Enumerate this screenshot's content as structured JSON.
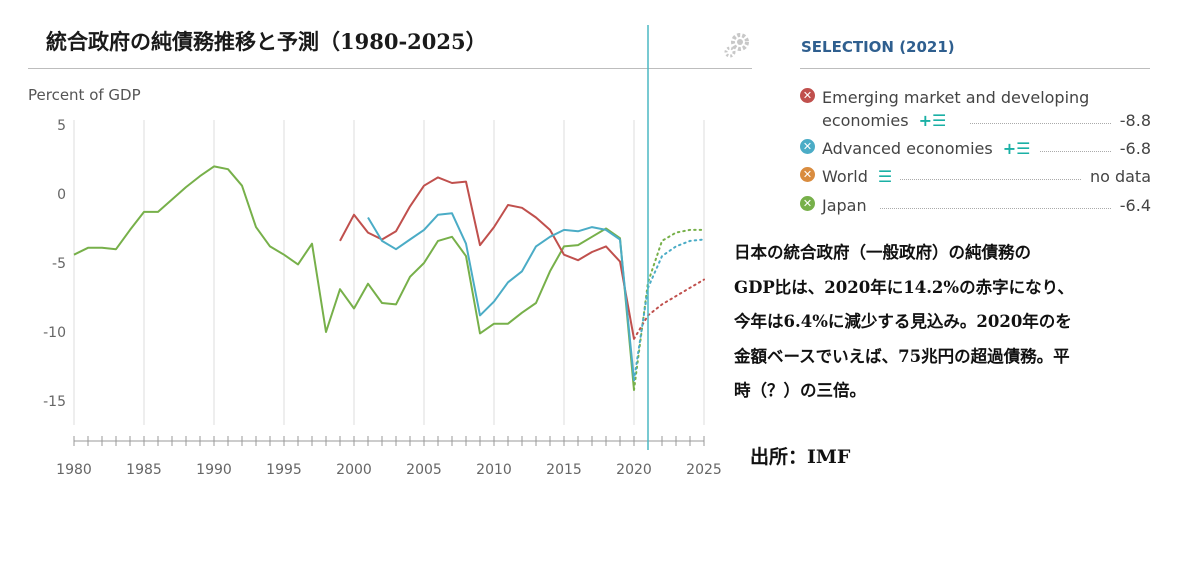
{
  "title": "統合政府の純債務推移と予測（1980-2025）",
  "selection_title": "SELECTION (2021)",
  "legend": [
    {
      "name_line1": "Emerging market and developing",
      "name_line2": "economies",
      "value": "-8.8",
      "color": "#c0504d",
      "icon": "plus-list-icon"
    },
    {
      "name_line1": "Advanced economies",
      "name_line2": "",
      "value": "-6.8",
      "color": "#4bacc6",
      "icon": "plus-list-icon"
    },
    {
      "name_line1": "World",
      "name_line2": "",
      "value": "no data",
      "color": "#d98c3f",
      "icon": "list-icon"
    },
    {
      "name_line1": "Japan",
      "name_line2": "",
      "value": "-6.4",
      "color": "#77b04a",
      "icon": ""
    }
  ],
  "note_lines": [
    "日本の統合政府（一般政府）の純債務の",
    "GDP比は、2020年に14.2%の赤字になり、",
    "今年は6.4%に減少する見込み。2020年のを",
    "金額ベースでいえば、75兆円の超過債務。平",
    "時（？）の三倍。"
  ],
  "source": "出所：IMF",
  "chart_data": {
    "type": "line",
    "ylabel": "Percent of GDP",
    "xlim": [
      1980,
      2025
    ],
    "ylim": [
      -17,
      6
    ],
    "x_ticks": [
      1980,
      1985,
      1990,
      1995,
      2000,
      2005,
      2010,
      2015,
      2020,
      2025
    ],
    "y_ticks": [
      5,
      0,
      -5,
      -10,
      -15
    ],
    "marker_year": 2021,
    "series": [
      {
        "name": "Japan",
        "color": "#77b04a",
        "x": [
          1980,
          1981,
          1982,
          1983,
          1984,
          1985,
          1986,
          1987,
          1988,
          1989,
          1990,
          1991,
          1992,
          1993,
          1994,
          1995,
          1996,
          1997,
          1998,
          1999,
          2000,
          2001,
          2002,
          2003,
          2004,
          2005,
          2006,
          2007,
          2008,
          2009,
          2010,
          2011,
          2012,
          2013,
          2014,
          2015,
          2016,
          2017,
          2018,
          2019,
          2020
        ],
        "y": [
          -4.4,
          -3.9,
          -3.9,
          -4.0,
          -2.6,
          -1.3,
          -1.3,
          -0.4,
          0.5,
          1.3,
          2.0,
          1.8,
          0.6,
          -2.4,
          -3.8,
          -4.4,
          -5.1,
          -3.6,
          -10.0,
          -6.9,
          -8.3,
          -6.5,
          -7.9,
          -8.0,
          -6.0,
          -5.0,
          -3.4,
          -3.1,
          -4.5,
          -10.1,
          -9.4,
          -9.4,
          -8.6,
          -7.9,
          -5.6,
          -3.8,
          -3.7,
          -3.1,
          -2.5,
          -3.2,
          -14.2
        ],
        "forecast_x": [
          2020,
          2021,
          2022,
          2023,
          2024,
          2025
        ],
        "forecast_y": [
          -14.2,
          -6.4,
          -3.4,
          -2.8,
          -2.6,
          -2.6
        ]
      },
      {
        "name": "Emerging market and developing economies",
        "color": "#c0504d",
        "x": [
          1999,
          2000,
          2001,
          2002,
          2003,
          2004,
          2005,
          2006,
          2007,
          2008,
          2009,
          2010,
          2011,
          2012,
          2013,
          2014,
          2015,
          2016,
          2017,
          2018,
          2019,
          2020
        ],
        "y": [
          -3.4,
          -1.5,
          -2.8,
          -3.3,
          -2.7,
          -0.9,
          0.6,
          1.2,
          0.8,
          0.9,
          -3.7,
          -2.4,
          -0.8,
          -1.0,
          -1.7,
          -2.6,
          -4.4,
          -4.8,
          -4.2,
          -3.8,
          -4.9,
          -10.5
        ],
        "forecast_x": [
          2020,
          2021,
          2022,
          2023,
          2024,
          2025
        ],
        "forecast_y": [
          -10.5,
          -8.8,
          -8.0,
          -7.4,
          -6.8,
          -6.2
        ]
      },
      {
        "name": "Advanced economies",
        "color": "#4bacc6",
        "x": [
          2001,
          2002,
          2003,
          2004,
          2005,
          2006,
          2007,
          2008,
          2009,
          2010,
          2011,
          2012,
          2013,
          2014,
          2015,
          2016,
          2017,
          2018,
          2019,
          2020
        ],
        "y": [
          -1.7,
          -3.4,
          -4.0,
          -3.3,
          -2.6,
          -1.5,
          -1.4,
          -3.6,
          -8.8,
          -7.8,
          -6.4,
          -5.6,
          -3.8,
          -3.1,
          -2.6,
          -2.7,
          -2.4,
          -2.6,
          -3.3,
          -13.5
        ],
        "forecast_x": [
          2020,
          2021,
          2022,
          2023,
          2024,
          2025
        ],
        "forecast_y": [
          -13.5,
          -6.8,
          -4.5,
          -3.8,
          -3.4,
          -3.3
        ]
      }
    ]
  }
}
